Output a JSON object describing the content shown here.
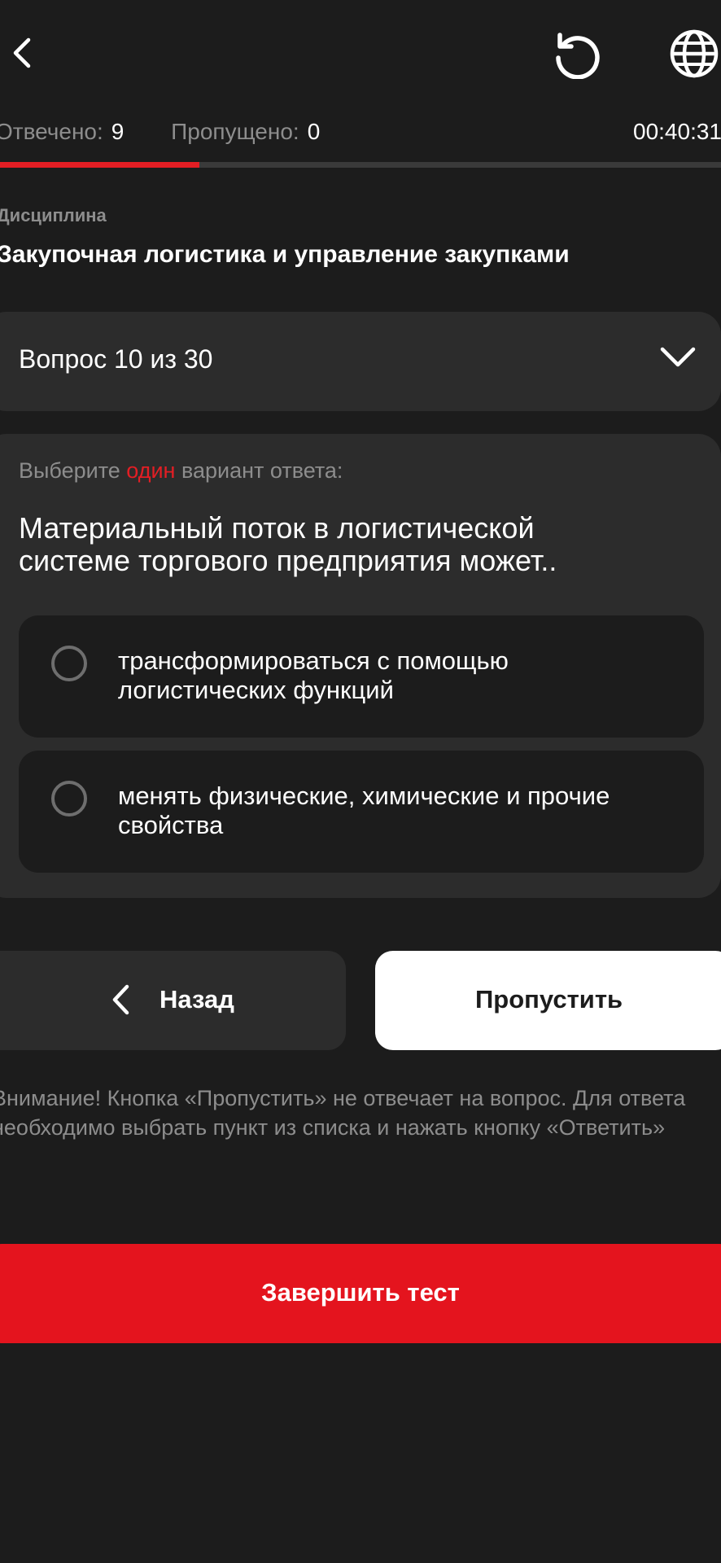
{
  "header": {
    "back_icon": "chevron-left-icon",
    "reset_icon": "refresh-icon",
    "language_icon": "globe-icon"
  },
  "stats": {
    "answered_label": "Отвечено:",
    "answered_value": "9",
    "skipped_label": "Пропущено:",
    "skipped_value": "0",
    "timer": "00:40:31"
  },
  "progress": {
    "answered_fraction": 0.277,
    "fill_color": "#e31e24",
    "track_color": "#3a3a3a"
  },
  "discipline": {
    "label": "Дисциплина",
    "title": "Закупочная логистика и управление закупками"
  },
  "question_selector": {
    "label": "Вопрос 10 из 30",
    "icon": "chevron-down-icon"
  },
  "question": {
    "instruction_before": "Выберите ",
    "instruction_accent": "один",
    "instruction_after": " вариант ответа:",
    "text": "Материальный поток в логистической системе торгового предприятия может..",
    "options": [
      {
        "text": "трансформироваться с помощью логистических функций",
        "selected": false
      },
      {
        "text": "менять физические, химические и прочие свойства",
        "selected": false
      }
    ]
  },
  "actions": {
    "back_label": "Назад",
    "skip_label": "Пропустить",
    "finish_label": "Завершить тест"
  },
  "warning": "Внимание! Кнопка «Пропустить» не отвечает на вопрос. Для ответа необходимо выбрать пункт из списка и нажать кнопку «Ответить»",
  "colors": {
    "background": "#1c1c1c",
    "card": "#2c2c2c",
    "accent": "#e31e24",
    "muted_text": "#8d8d8d"
  }
}
